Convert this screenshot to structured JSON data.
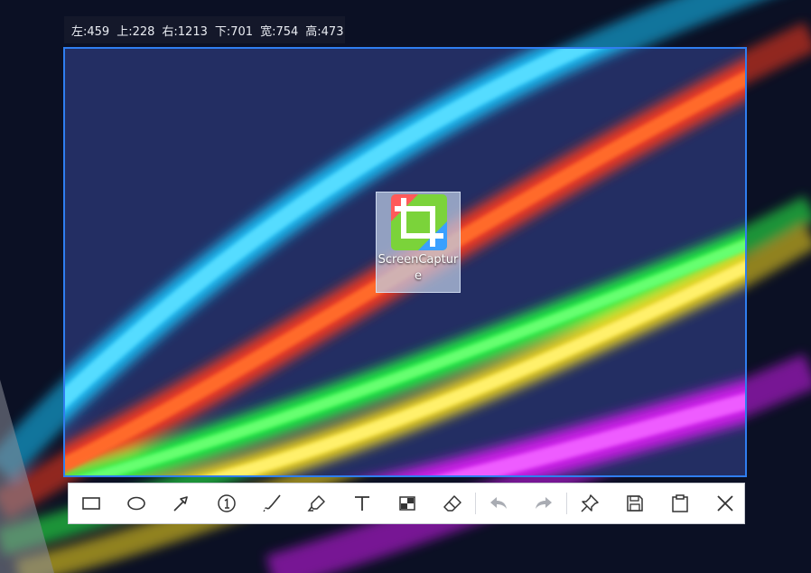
{
  "info": {
    "left": "左:459",
    "top": "上:228",
    "right": "右:1213",
    "bottom": "下:701",
    "width": "宽:754",
    "height": "高:473"
  },
  "desktop_icon": {
    "name": "ScreenCapture",
    "icon": "crop-icon"
  },
  "toolbar": {
    "tools": [
      {
        "name": "rectangle-tool",
        "icon": "rectangle-icon"
      },
      {
        "name": "ellipse-tool",
        "icon": "ellipse-icon"
      },
      {
        "name": "arrow-tool",
        "icon": "arrow-icon"
      },
      {
        "name": "number-tool",
        "icon": "numbered-circle-icon"
      },
      {
        "name": "pen-tool",
        "icon": "brush-icon"
      },
      {
        "name": "highlighter-tool",
        "icon": "highlighter-icon"
      },
      {
        "name": "text-tool",
        "icon": "text-icon"
      },
      {
        "name": "mosaic-tool",
        "icon": "mosaic-icon"
      },
      {
        "name": "eraser-tool",
        "icon": "eraser-icon"
      },
      {
        "name": "undo-button",
        "icon": "undo-icon",
        "disabled": true
      },
      {
        "name": "redo-button",
        "icon": "redo-icon",
        "disabled": true
      },
      {
        "name": "pin-button",
        "icon": "pin-icon"
      },
      {
        "name": "save-button",
        "icon": "save-icon"
      },
      {
        "name": "copy-button",
        "icon": "clipboard-icon"
      },
      {
        "name": "close-button",
        "icon": "close-icon"
      }
    ]
  },
  "colors": {
    "selection_border": "#2f7ef0",
    "toolbar_icon": "#333333",
    "toolbar_icon_disabled": "#a9acb3"
  }
}
